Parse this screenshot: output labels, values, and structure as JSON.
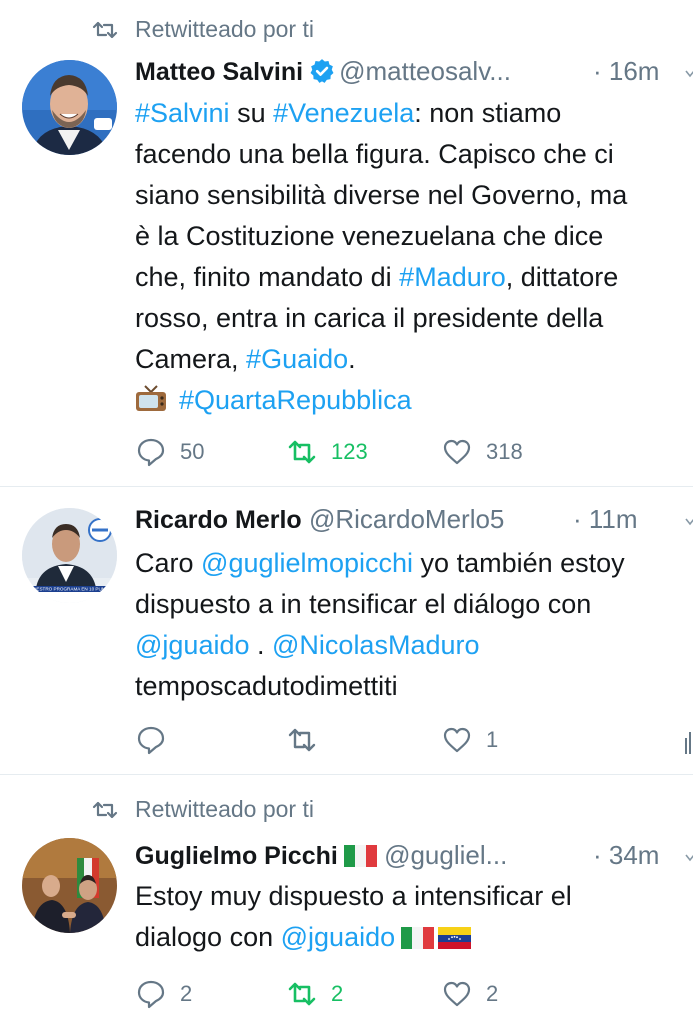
{
  "tweets": [
    {
      "retweet_label": "Retwitteado por ti",
      "name": "Matteo Salvini",
      "handle": "@matteosalv...",
      "time": "· 16m",
      "lines": [
        [
          {
            "t": "#Salvini",
            "link": true
          },
          {
            "t": " su "
          },
          {
            "t": "#Venezuela",
            "link": true
          },
          {
            "t": ": non stiamo"
          }
        ],
        [
          {
            "t": "facendo una bella figura. Capisco che ci"
          }
        ],
        [
          {
            "t": "siano sensibilità diverse nel Governo, ma"
          }
        ],
        [
          {
            "t": "è la Costituzione venezuelana che dice"
          }
        ],
        [
          {
            "t": "che, finito mandato di "
          },
          {
            "t": "#Maduro",
            "link": true
          },
          {
            "t": ", dittatore"
          }
        ],
        [
          {
            "t": "rosso, entra in carica il presidente della"
          }
        ],
        [
          {
            "t": "Camera, "
          },
          {
            "t": "#Guaido",
            "link": true
          },
          {
            "t": "."
          }
        ],
        [
          {
            "t": "#QuartaRepubblica",
            "link": true,
            "tv": true
          }
        ]
      ],
      "replies": "50",
      "retweets": "123",
      "likes": "318"
    },
    {
      "name": "Ricardo Merlo",
      "handle": "@RicardoMerlo5",
      "time": "· 11m",
      "avatar_banner": "NUESTRO PROGRAMA EN 10 PUNTI",
      "lines": [
        [
          {
            "t": "Caro "
          },
          {
            "t": "@guglielmopicchi",
            "link": true
          },
          {
            "t": " yo también estoy"
          }
        ],
        [
          {
            "t": "dispuesto a in tensificar el diálogo con"
          }
        ],
        [
          {
            "t": "@jguaido",
            "link": true
          },
          {
            "t": " . "
          },
          {
            "t": "@NicolasMaduro",
            "link": true
          }
        ],
        [
          {
            "t": "temposcadutodimettiti"
          }
        ]
      ],
      "replies": "",
      "retweets": "",
      "likes": "1"
    },
    {
      "retweet_label": "Retwitteado por ti",
      "name": "Guglielmo Picchi",
      "handle": "@gugliel...",
      "time": "· 34m",
      "lines": [
        [
          {
            "t": "Estoy muy dispuesto a intensificar el"
          }
        ],
        [
          {
            "t": "dialogo con "
          },
          {
            "t": "@jguaido",
            "link": true
          }
        ]
      ],
      "replies": "2",
      "retweets": "2",
      "likes": "2"
    }
  ],
  "colors": {
    "link": "#1da1f2",
    "muted": "#657786",
    "retweet_green": "#17bf63",
    "verified": "#1da1f2"
  }
}
